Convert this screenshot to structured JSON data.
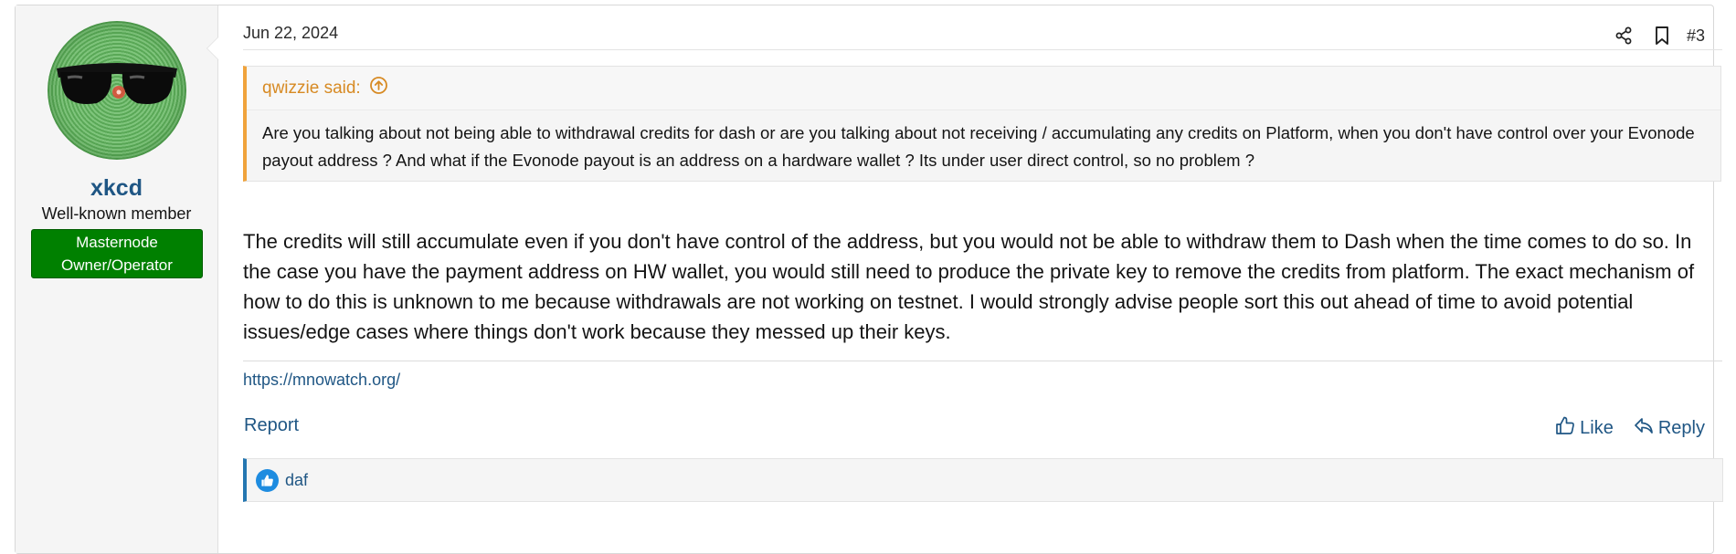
{
  "post": {
    "date": "Jun 22, 2024",
    "number": "#3",
    "user": {
      "name": "xkcd",
      "title": "Well-known member",
      "banner": "Masternode Owner/Operator",
      "banner_color": "#008000"
    },
    "quote": {
      "author": "qwizzie said:",
      "text": "Are you talking about not being able to withdrawal credits for dash or are you talking about not receiving / accumulating any credits on Platform, when you don't have control over your Evonode payout address ? And what if the Evonode payout is an address on a hardware wallet ? Its under user direct control, so no problem ?",
      "accent_color": "#f0a33c"
    },
    "message": "The credits will still accumulate even if you don't have control of the address, but you would not be able to withdraw them to Dash when the time comes to do so. In the case you have the payment address on HW wallet, you would still need to produce the private key to remove the credits from platform. The exact mechanism of how to do this is unknown to me because withdrawals are not working on testnet. I would strongly advise people sort this out ahead of time to avoid potential issues/edge cases where things don't work because they messed up their keys.",
    "signature_link": "https://mnowatch.org/",
    "actions": {
      "report": "Report",
      "like": "Like",
      "reply": "Reply"
    },
    "reactions": {
      "icon": "thumbs-up-icon",
      "users": "daf"
    },
    "icons": [
      "share-icon",
      "bookmark-icon",
      "arrow-up-circle-icon",
      "like-icon",
      "reply-icon"
    ],
    "link_color": "#1f5684"
  }
}
